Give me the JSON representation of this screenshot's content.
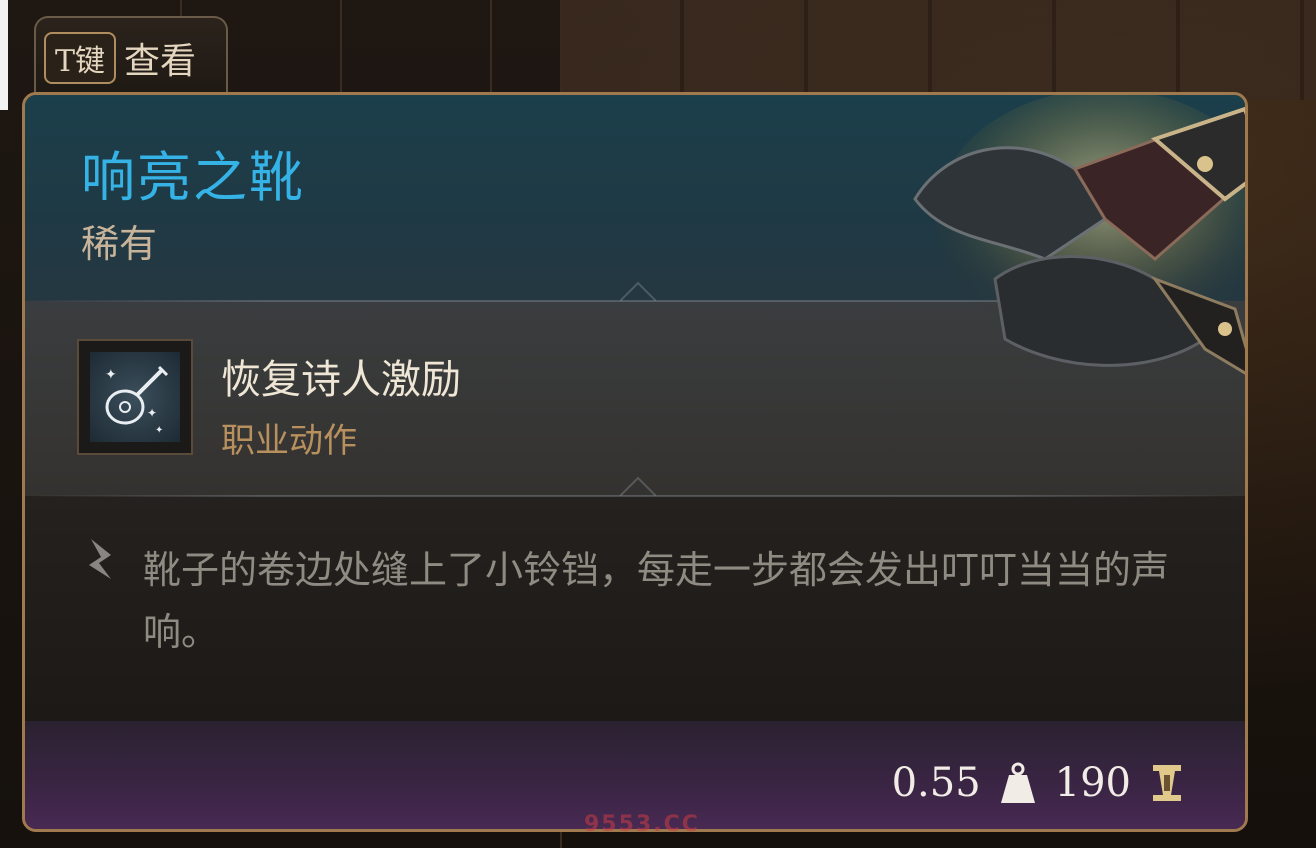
{
  "header_tab": {
    "key_label": "T键",
    "action_label": "查看"
  },
  "item": {
    "name": "响亮之靴",
    "rarity": "稀有"
  },
  "granted_action": {
    "name": "恢复诗人激励",
    "type": "职业动作",
    "icon": "lute-icon"
  },
  "description": "靴子的卷边处缝上了小铃铛，每走一步都会发出叮叮当当的声响。",
  "footer": {
    "weight": "0.55",
    "weight_icon": "weight-icon",
    "value": "190",
    "value_icon": "gold-icon"
  },
  "watermark": "9553.CC",
  "colors": {
    "title": "#35b3e6",
    "rarity": "#c8b49a",
    "action_type": "#b8905e",
    "border": "#a07a4e"
  }
}
